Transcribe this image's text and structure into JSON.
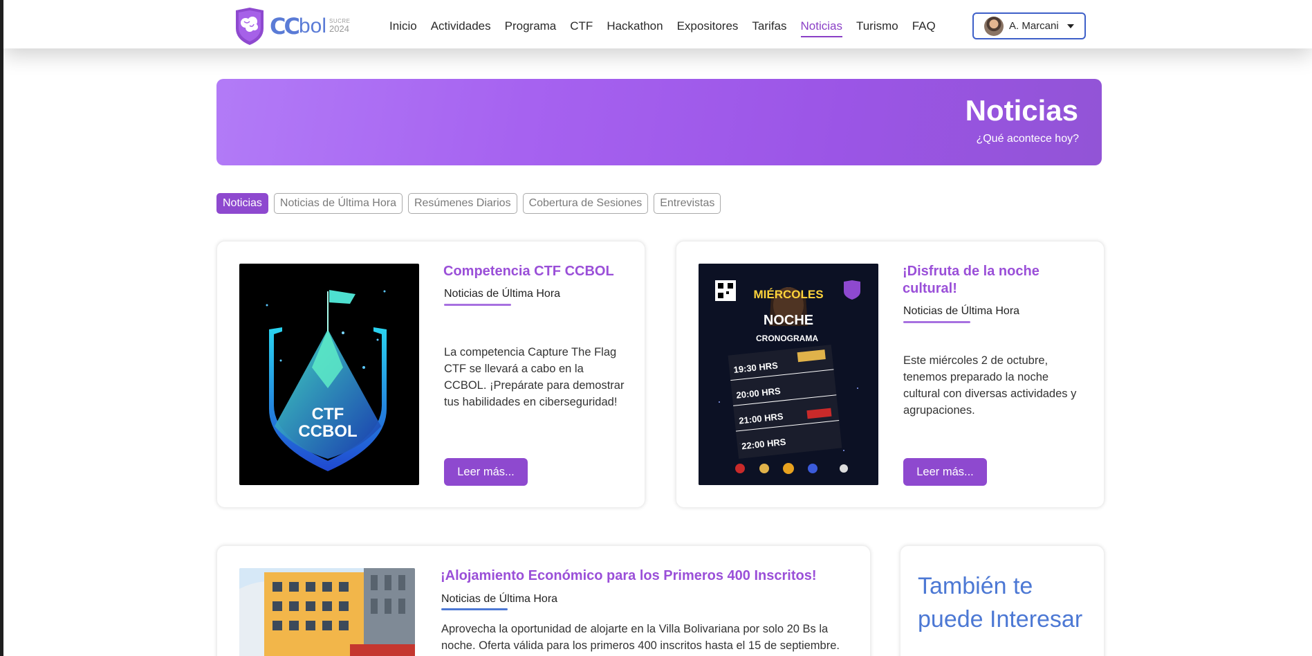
{
  "brand": {
    "cc": "CC",
    "bol": "bol",
    "sucre": "SUCRE",
    "year": "2024"
  },
  "nav": {
    "items": [
      {
        "label": "Inicio"
      },
      {
        "label": "Actividades"
      },
      {
        "label": "Programa"
      },
      {
        "label": "CTF"
      },
      {
        "label": "Hackathon"
      },
      {
        "label": "Expositores"
      },
      {
        "label": "Tarifas"
      },
      {
        "label": "Noticias",
        "active": true
      },
      {
        "label": "Turismo"
      },
      {
        "label": "FAQ"
      }
    ],
    "user": "A. Marcani"
  },
  "hero": {
    "title": "Noticias",
    "subtitle": "¿Qué acontece hoy?"
  },
  "filters": [
    "Noticias",
    "Noticias de Última Hora",
    "Resúmenes Diarios",
    "Cobertura de Sesiones",
    "Entrevistas"
  ],
  "cards": [
    {
      "title": "Competencia CTF CCBOL",
      "category": "Noticias de Última Hora",
      "text": "La competencia Capture The Flag CTF se llevará a cabo en la CCBOL. ¡Prepárate para demostrar tus habilidades en ciberseguridad!",
      "button": "Leer más...",
      "image_text": [
        "CTF",
        "CCBOL"
      ]
    },
    {
      "title": "¡Disfruta de la noche cultural!",
      "category": "Noticias de Última Hora",
      "text": "Este miércoles 2 de octubre, tenemos preparado la noche cultural con diversas actividades y agrupaciones.",
      "button": "Leer más...",
      "image_text": [
        "MIÉRCOLES",
        "NOCHE",
        "CRONOGRAMA",
        "19:30 HRS",
        "20:00 HRS",
        "21:00 HRS",
        "22:00 HRS"
      ]
    },
    {
      "title": "¡Alojamiento Económico para los Primeros 400 Inscritos!",
      "category": "Noticias de Última Hora",
      "text": "Aprovecha la oportunidad de alojarte en la Villa Bolivariana por solo 20 Bs la noche. Oferta válida para los primeros 400 inscritos hasta el 15 de septiembre."
    }
  ],
  "sidebar": {
    "title": "También te puede Interesar"
  },
  "colors": {
    "accent": "#8e49cf",
    "hero_start": "#b27bf7",
    "hero_end": "#9254d6",
    "blue": "#4c78d4"
  }
}
